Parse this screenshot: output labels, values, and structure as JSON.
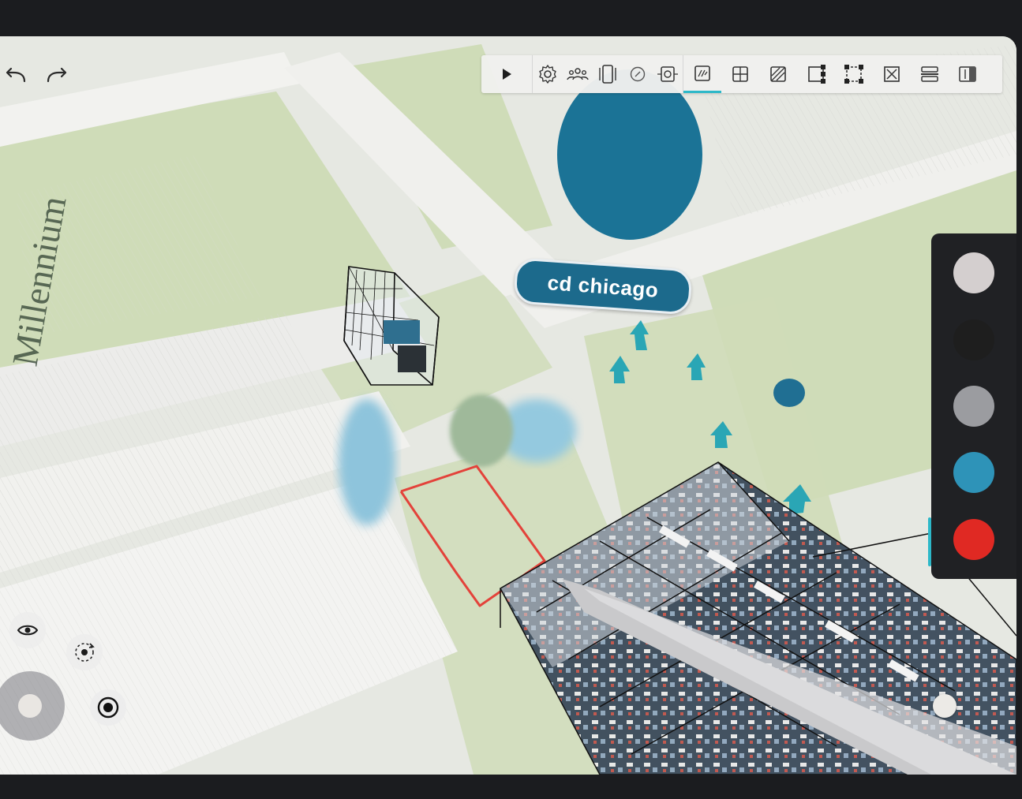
{
  "label_chip": {
    "text": "cd chicago"
  },
  "map_text": "Millennium",
  "history": {
    "undo_icon": "undo-icon",
    "redo_icon": "redo-icon"
  },
  "toolbar": {
    "groups": [
      [
        "play-icon"
      ],
      [
        "settings-icon",
        "people-icon",
        "device-frame-icon",
        "compass-icon",
        "focus-target-icon"
      ],
      [
        "measure-icon",
        "grid-add-icon",
        "hatch-pattern-icon",
        "node-select-icon",
        "box-select-icon",
        "crossed-box-icon",
        "horizontal-split-icon",
        "side-panel-icon"
      ]
    ]
  },
  "palette": {
    "colors": [
      "#d4cfcf",
      "#1e1e1e",
      "#9b9ca0",
      "#2e93b8",
      "#e02923"
    ],
    "selected_index": 3
  },
  "controls": {
    "eye_icon": "eye-icon",
    "orbit_icon": "orbit-icon",
    "joystick": "joystick",
    "record_icon": "record-icon"
  },
  "colors": {
    "accent": "#2db8c8",
    "chip_bg": "#1c6a8c",
    "marker_teal": "#2aa6b5",
    "sketch_red": "#e3423a",
    "map_green": "#cfdcb8",
    "map_road": "#eeeeeb"
  }
}
